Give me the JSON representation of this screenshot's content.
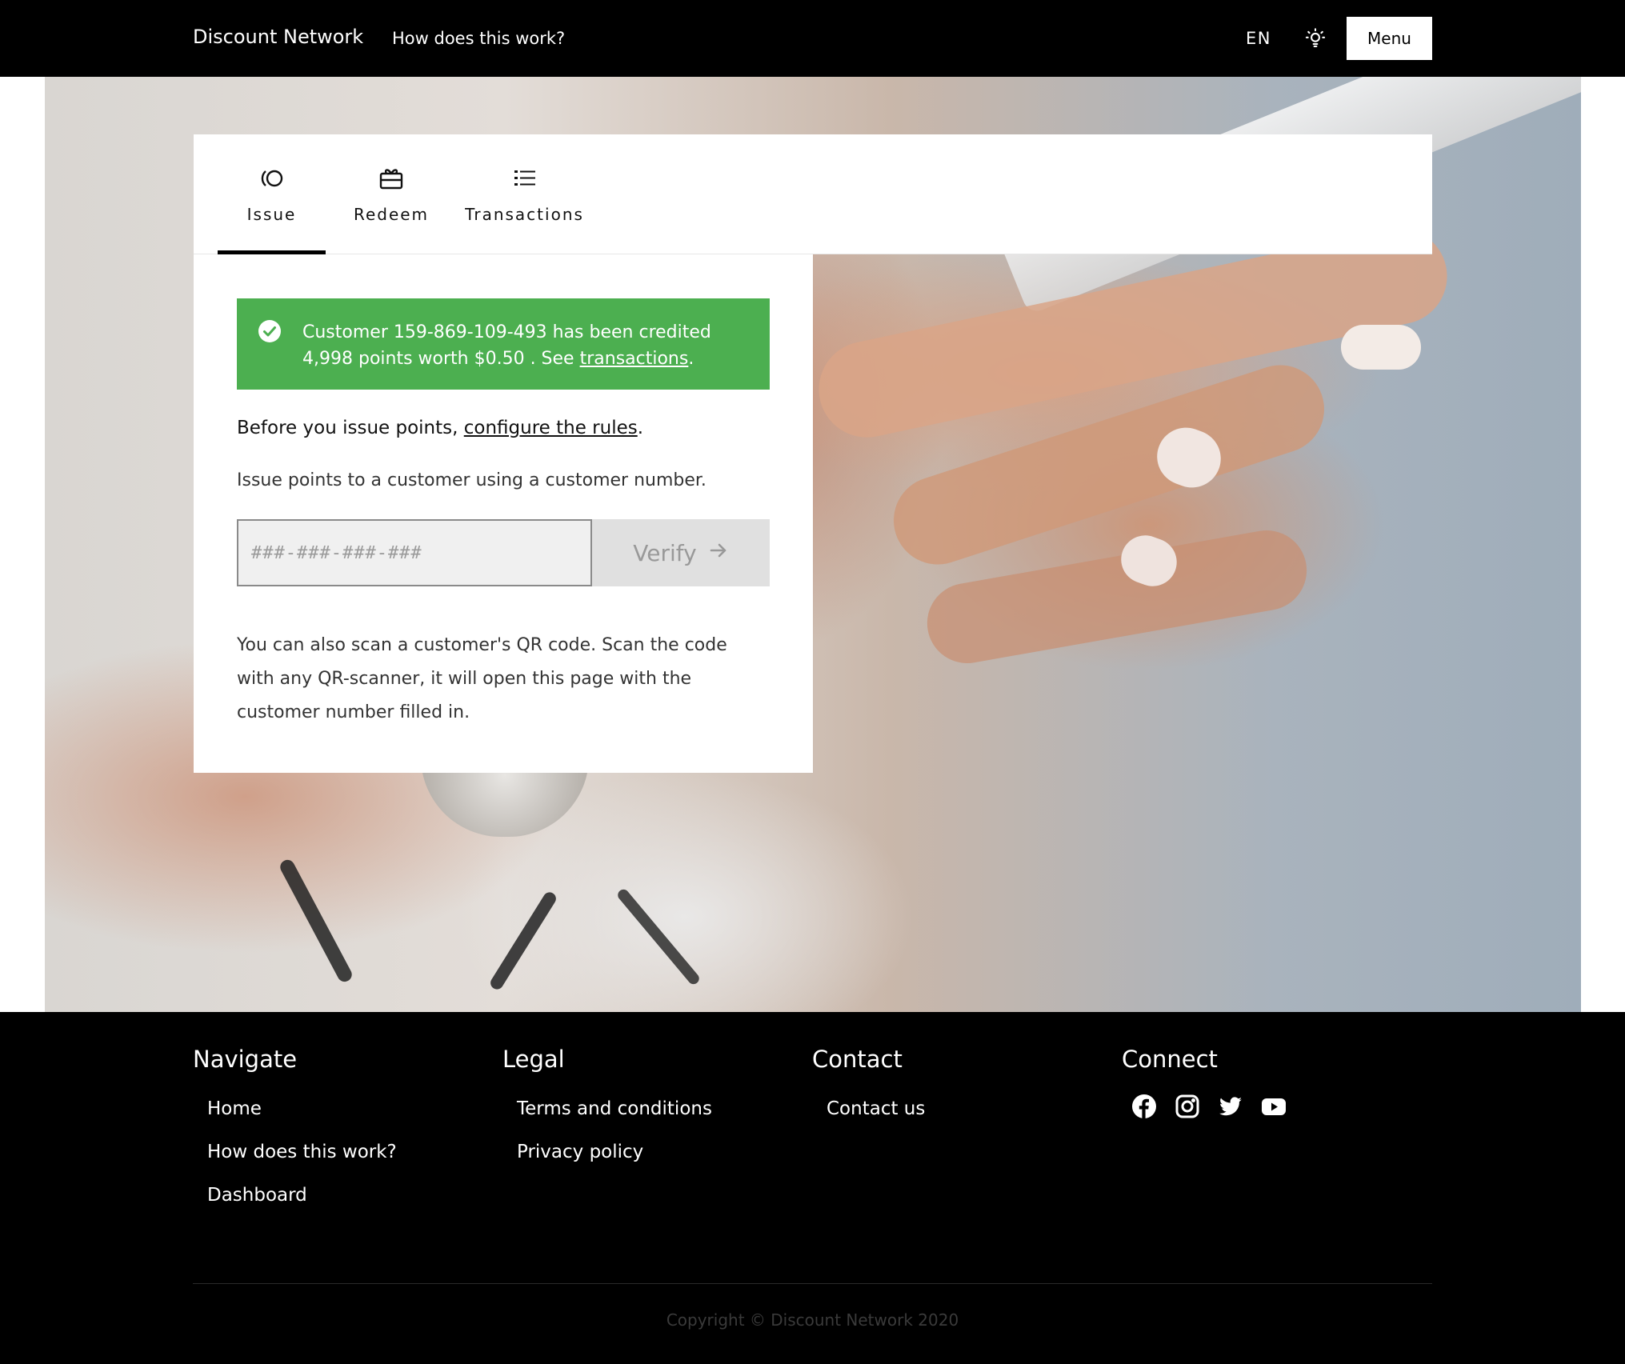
{
  "nav": {
    "brand": "Discount Network",
    "how_link": "How does this work?",
    "language": "EN",
    "theme_icon": "lightbulb-icon",
    "menu_label": "Menu"
  },
  "tabs": [
    {
      "label": "Issue",
      "icon": "issue-points-icon",
      "active": true
    },
    {
      "label": "Redeem",
      "icon": "gift-card-icon",
      "active": false
    },
    {
      "label": "Transactions",
      "icon": "list-icon",
      "active": false
    }
  ],
  "alert": {
    "color": "#4caf50",
    "icon": "check-circle-icon",
    "text_before": "Customer 159-869-109-493 has been credited 4,998 points worth $0.50 . See ",
    "link": "transactions",
    "text_after": "."
  },
  "issue": {
    "rules_prefix": "Before you issue points, ",
    "rules_link": "configure the rules",
    "rules_suffix": ".",
    "help": "Issue points to a customer using a customer number.",
    "input_placeholder": "###-###-###-###",
    "input_value": "",
    "verify_label": "Verify",
    "qr_help": "You can also scan a customer's QR code. Scan the code with any QR-scanner, it will open this page with the customer number filled in."
  },
  "footer": {
    "navigate": {
      "heading": "Navigate",
      "links": [
        "Home",
        "How does this work?",
        "Dashboard"
      ]
    },
    "legal": {
      "heading": "Legal",
      "links": [
        "Terms and conditions",
        "Privacy policy"
      ]
    },
    "contact": {
      "heading": "Contact",
      "links": [
        "Contact us"
      ]
    },
    "connect": {
      "heading": "Connect",
      "icons": [
        "facebook-icon",
        "instagram-icon",
        "twitter-icon",
        "youtube-icon"
      ]
    },
    "copyright": "Copyright © Discount Network 2020"
  }
}
